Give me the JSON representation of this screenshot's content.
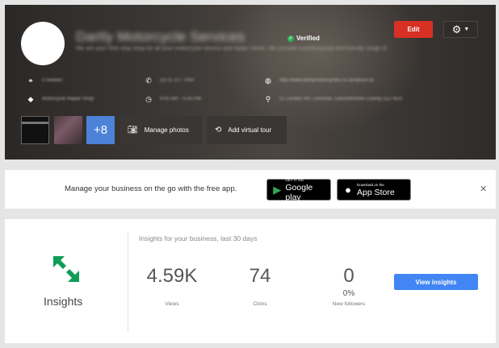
{
  "header": {
    "business_name": "Dartly Motorcycle Services",
    "verified_label": "Verified",
    "tagline": "We are your One stop shop for all your motorcycle service and repair needs. We provide a professional and friendly range of",
    "edit_label": "Edit",
    "info": {
      "reviews": "0 reviews",
      "phone": "(0) 01 377 7000",
      "website": "http://www.dartlymotorcycles.co.uk/about-us",
      "category": "Motorcycle Repair Shop",
      "hours": "9:00 AM – 5:00 PM",
      "address": "51 London Rd, Leicester, Leicestershire County LE2 0EH"
    },
    "more_photos": "+8",
    "manage_photos_label": "Manage photos",
    "virtual_tour_label": "Add virtual tour"
  },
  "promo": {
    "text": "Manage your business on the go with the free app.",
    "google_play_sub": "GET IT ON",
    "google_play_main": "Google play",
    "app_store_sub": "Download on the",
    "app_store_main": "App Store"
  },
  "insights": {
    "title": "Insights",
    "subtitle": "Insights for your business, last 30 days",
    "views_value": "4.59K",
    "views_label": "Views",
    "clicks_value": "74",
    "clicks_label": "Clicks",
    "followers_value": "0",
    "followers_pct": "0%",
    "followers_label": "New followers",
    "view_button": "View insights"
  },
  "colors": {
    "edit_red": "#d93025",
    "insights_blue": "#4285f4",
    "verified_green": "#2fb157",
    "insights_icon_green": "#0f9d58"
  }
}
